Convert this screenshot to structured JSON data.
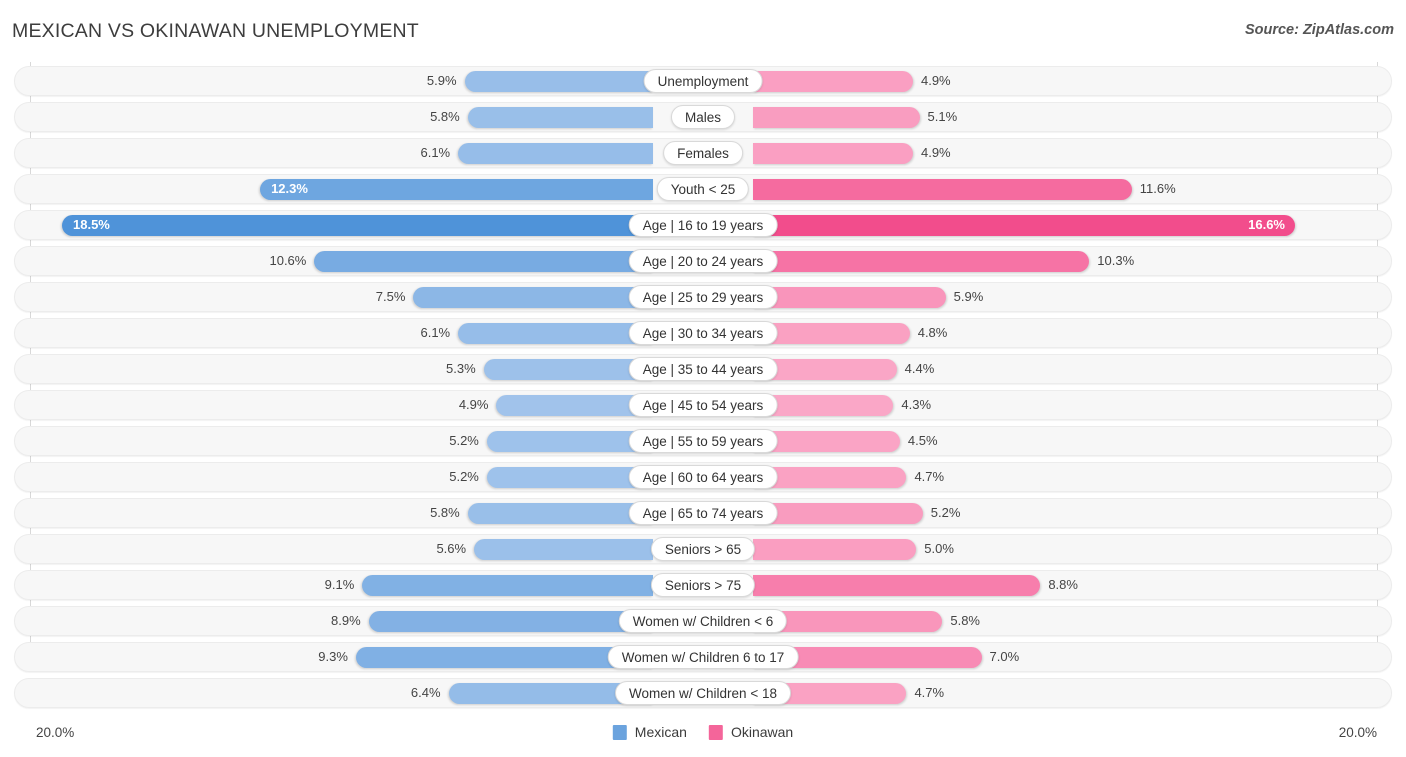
{
  "header": {
    "title": "MEXICAN VS OKINAWAN UNEMPLOYMENT",
    "source": "Source: ZipAtlas.com"
  },
  "footer": {
    "axis_left": "20.0%",
    "axis_right": "20.0%",
    "legend": [
      {
        "label": "Mexican",
        "color": "#6ba3de"
      },
      {
        "label": "Okinawan",
        "color": "#f4659a"
      }
    ]
  },
  "chart_data": {
    "type": "bar",
    "subtype": "diverging-bidirectional-bar",
    "title": "MEXICAN VS OKINAWAN UNEMPLOYMENT",
    "source": "Source: ZipAtlas.com",
    "xlabel": "",
    "ylabel": "",
    "xlim": [
      -20.0,
      20.0
    ],
    "axis_max": 20.0,
    "unit": "%",
    "grid": false,
    "legend_position": "bottom-center",
    "categories": [
      "Unemployment",
      "Males",
      "Females",
      "Youth < 25",
      "Age | 16 to 19 years",
      "Age | 20 to 24 years",
      "Age | 25 to 29 years",
      "Age | 30 to 34 years",
      "Age | 35 to 44 years",
      "Age | 45 to 54 years",
      "Age | 55 to 59 years",
      "Age | 60 to 64 years",
      "Age | 65 to 74 years",
      "Seniors > 65",
      "Seniors > 75",
      "Women w/ Children < 6",
      "Women w/ Children 6 to 17",
      "Women w/ Children < 18"
    ],
    "series": [
      {
        "name": "Mexican",
        "side": "left",
        "color": "#6ba3de",
        "values": [
          5.9,
          5.8,
          6.1,
          12.3,
          18.5,
          10.6,
          7.5,
          6.1,
          5.3,
          4.9,
          5.2,
          5.2,
          5.8,
          5.6,
          9.1,
          8.9,
          9.3,
          6.4
        ],
        "labels": [
          "5.9%",
          "5.8%",
          "6.1%",
          "12.3%",
          "18.5%",
          "10.6%",
          "7.5%",
          "6.1%",
          "5.3%",
          "4.9%",
          "5.2%",
          "5.2%",
          "5.8%",
          "5.6%",
          "9.1%",
          "8.9%",
          "9.3%",
          "6.4%"
        ]
      },
      {
        "name": "Okinawan",
        "side": "right",
        "color": "#f4659a",
        "values": [
          4.9,
          5.1,
          4.9,
          11.6,
          16.6,
          10.3,
          5.9,
          4.8,
          4.4,
          4.3,
          4.5,
          4.7,
          5.2,
          5.0,
          8.8,
          5.8,
          7.0,
          4.7
        ],
        "labels": [
          "4.9%",
          "5.1%",
          "4.9%",
          "11.6%",
          "16.6%",
          "10.3%",
          "5.9%",
          "4.8%",
          "4.4%",
          "4.3%",
          "4.5%",
          "4.7%",
          "5.2%",
          "5.0%",
          "8.8%",
          "5.8%",
          "7.0%",
          "4.7%"
        ]
      }
    ],
    "rows": [
      {
        "label": "Unemployment",
        "left": 5.9,
        "left_label": "5.9%",
        "right": 4.9,
        "right_label": "4.9%",
        "left_inside": false,
        "right_inside": false
      },
      {
        "label": "Males",
        "left": 5.8,
        "left_label": "5.8%",
        "right": 5.1,
        "right_label": "5.1%",
        "left_inside": false,
        "right_inside": false
      },
      {
        "label": "Females",
        "left": 6.1,
        "left_label": "6.1%",
        "right": 4.9,
        "right_label": "4.9%",
        "left_inside": false,
        "right_inside": false
      },
      {
        "label": "Youth < 25",
        "left": 12.3,
        "left_label": "12.3%",
        "right": 11.6,
        "right_label": "11.6%",
        "left_inside": true,
        "right_inside": false
      },
      {
        "label": "Age | 16 to 19 years",
        "left": 18.5,
        "left_label": "18.5%",
        "right": 16.6,
        "right_label": "16.6%",
        "left_inside": true,
        "right_inside": true
      },
      {
        "label": "Age | 20 to 24 years",
        "left": 10.6,
        "left_label": "10.6%",
        "right": 10.3,
        "right_label": "10.3%",
        "left_inside": false,
        "right_inside": false
      },
      {
        "label": "Age | 25 to 29 years",
        "left": 7.5,
        "left_label": "7.5%",
        "right": 5.9,
        "right_label": "5.9%",
        "left_inside": false,
        "right_inside": false
      },
      {
        "label": "Age | 30 to 34 years",
        "left": 6.1,
        "left_label": "6.1%",
        "right": 4.8,
        "right_label": "4.8%",
        "left_inside": false,
        "right_inside": false
      },
      {
        "label": "Age | 35 to 44 years",
        "left": 5.3,
        "left_label": "5.3%",
        "right": 4.4,
        "right_label": "4.4%",
        "left_inside": false,
        "right_inside": false
      },
      {
        "label": "Age | 45 to 54 years",
        "left": 4.9,
        "left_label": "4.9%",
        "right": 4.3,
        "right_label": "4.3%",
        "left_inside": false,
        "right_inside": false
      },
      {
        "label": "Age | 55 to 59 years",
        "left": 5.2,
        "left_label": "5.2%",
        "right": 4.5,
        "right_label": "4.5%",
        "left_inside": false,
        "right_inside": false
      },
      {
        "label": "Age | 60 to 64 years",
        "left": 5.2,
        "left_label": "5.2%",
        "right": 4.7,
        "right_label": "4.7%",
        "left_inside": false,
        "right_inside": false
      },
      {
        "label": "Age | 65 to 74 years",
        "left": 5.8,
        "left_label": "5.8%",
        "right": 5.2,
        "right_label": "5.2%",
        "left_inside": false,
        "right_inside": false
      },
      {
        "label": "Seniors > 65",
        "left": 5.6,
        "left_label": "5.6%",
        "right": 5.0,
        "right_label": "5.0%",
        "left_inside": false,
        "right_inside": false
      },
      {
        "label": "Seniors > 75",
        "left": 9.1,
        "left_label": "9.1%",
        "right": 8.8,
        "right_label": "8.8%",
        "left_inside": false,
        "right_inside": false
      },
      {
        "label": "Women w/ Children < 6",
        "left": 8.9,
        "left_label": "8.9%",
        "right": 5.8,
        "right_label": "5.8%",
        "left_inside": false,
        "right_inside": false
      },
      {
        "label": "Women w/ Children 6 to 17",
        "left": 9.3,
        "left_label": "9.3%",
        "right": 7.0,
        "right_label": "7.0%",
        "left_inside": false,
        "right_inside": false
      },
      {
        "label": "Women w/ Children < 18",
        "left": 6.4,
        "left_label": "6.4%",
        "right": 4.7,
        "right_label": "4.7%",
        "left_inside": false,
        "right_inside": false
      }
    ]
  }
}
